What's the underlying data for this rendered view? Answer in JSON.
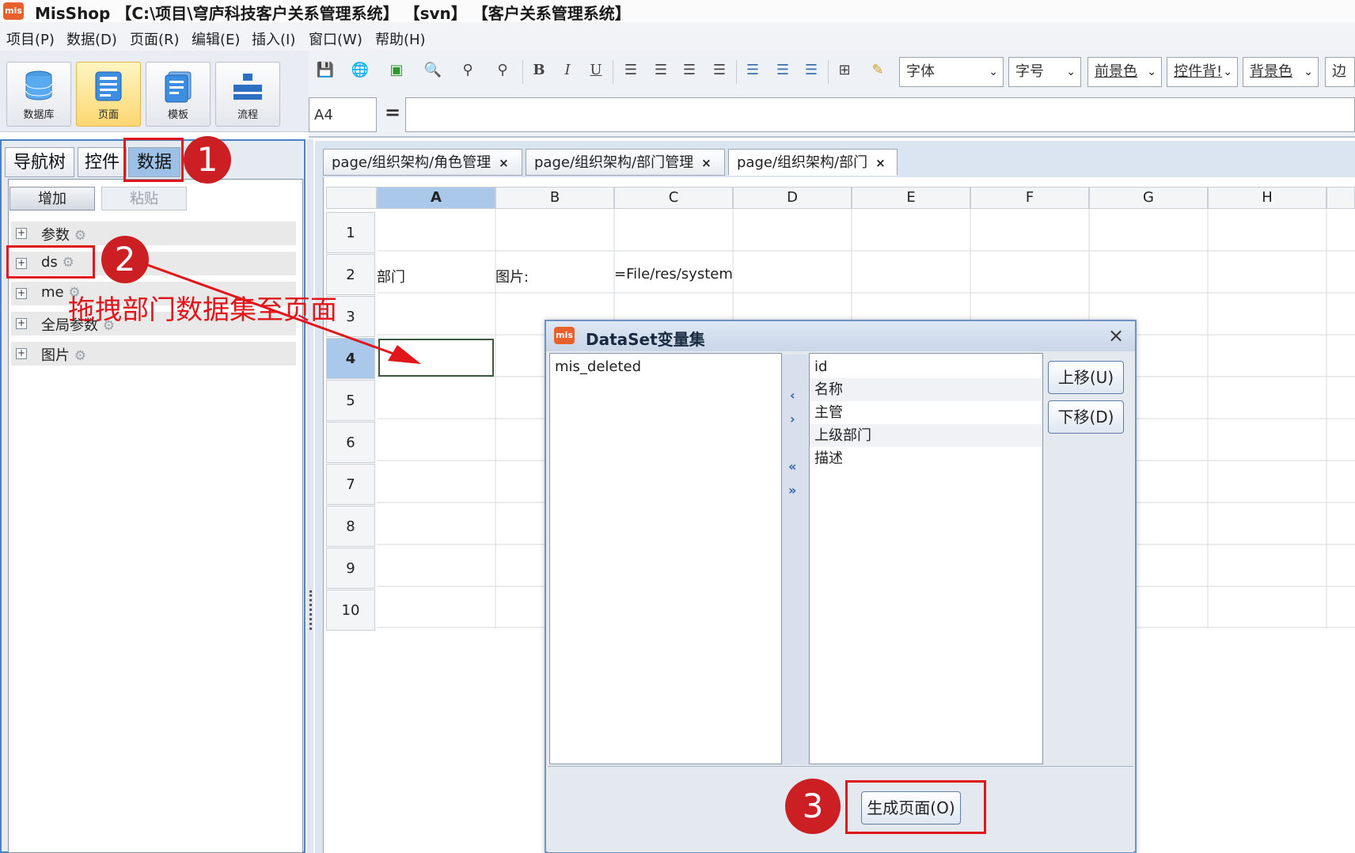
{
  "window": {
    "title": "MisShop 【C:\\项目\\穹庐科技客户关系管理系统】 【svn】 【客户关系管理系统】",
    "logo_text": "mis"
  },
  "menu": [
    "项目(P)",
    "数据(D)",
    "页面(R)",
    "编辑(E)",
    "插入(I)",
    "窗口(W)",
    "帮助(H)"
  ],
  "big_toolbar": [
    {
      "label": "数据库",
      "icon": "database-icon"
    },
    {
      "label": "页面",
      "icon": "page-icon",
      "active": true
    },
    {
      "label": "模板",
      "icon": "template-icon"
    },
    {
      "label": "流程",
      "icon": "flow-icon"
    }
  ],
  "format_toolbar": {
    "font_placeholder": "字体",
    "size_placeholder": "字号",
    "fg_color": "前景色",
    "control_bg": "控件背!",
    "bg_color": "背景色",
    "border": "边框"
  },
  "formula_bar": {
    "cell_ref": "A4",
    "eq": "=",
    "formula": ""
  },
  "left_panel": {
    "tabs": [
      "导航树",
      "控件",
      "数据"
    ],
    "active_tab": "数据",
    "buttons": {
      "add": "增加",
      "paste": "粘贴"
    },
    "tree": [
      "参数",
      "ds",
      "me",
      "全局参数",
      "图片"
    ]
  },
  "editor_tabs": [
    {
      "label": "page/组织架构/角色管理",
      "close": "×"
    },
    {
      "label": "page/组织架构/部门管理",
      "close": "×"
    },
    {
      "label": "page/组织架构/部门",
      "close": "×",
      "active": true
    }
  ],
  "sheet": {
    "columns": [
      "A",
      "B",
      "C",
      "D",
      "E",
      "F",
      "G",
      "H"
    ],
    "rows": [
      "1",
      "2",
      "3",
      "4",
      "5",
      "6",
      "7",
      "8",
      "9",
      "10"
    ],
    "selected_col": "A",
    "selected_row": "4",
    "cells": {
      "A2": "部门",
      "B2": "图片:",
      "C2": "=File/res/system"
    }
  },
  "dialog": {
    "title": "DataSet变量集",
    "close": "×",
    "left_list": [
      "mis_deleted"
    ],
    "right_list": [
      "id",
      "名称",
      "主管",
      "上级部门",
      "描述"
    ],
    "move_buttons": {
      "left": "‹",
      "right": "›",
      "all_left": "«",
      "all_right": "»"
    },
    "up_button": "上移(U)",
    "down_button": "下移(D)",
    "generate_button": "生成页面(O)"
  },
  "annotations": {
    "badge1": "1",
    "badge2": "2",
    "badge3": "3",
    "note": "拖拽部门数据集至页面",
    "color": "#e0161b"
  }
}
